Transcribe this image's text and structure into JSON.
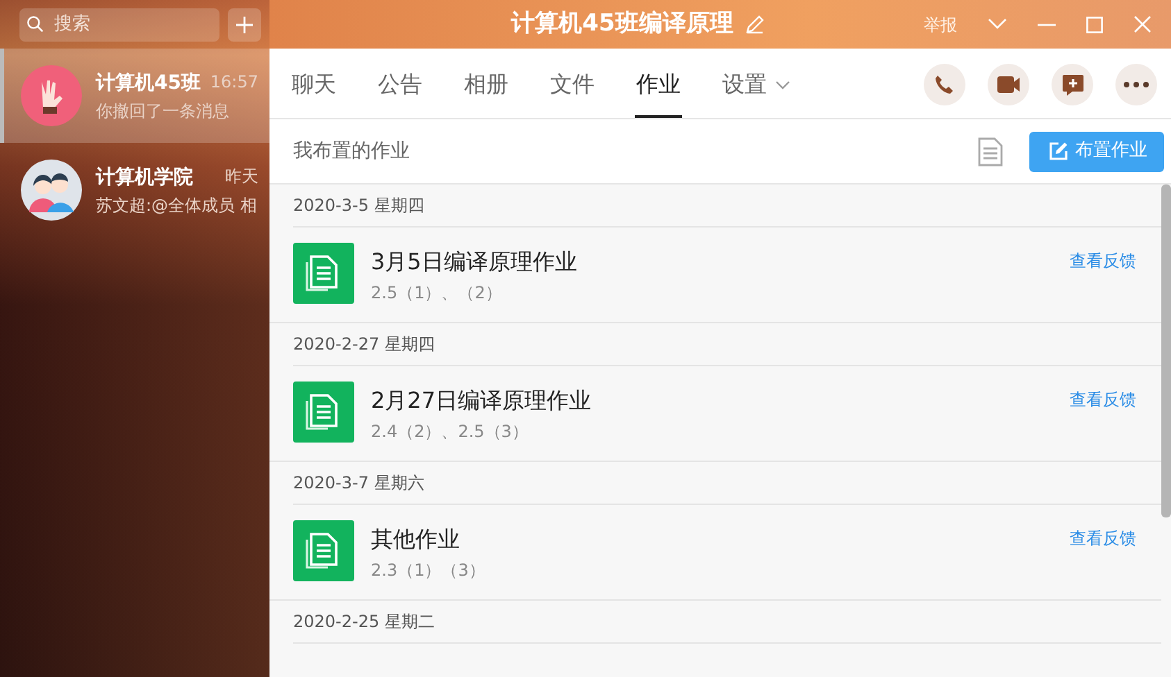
{
  "search": {
    "placeholder": "搜索"
  },
  "conversations": [
    {
      "name": "计算机45班",
      "time": "16:57",
      "preview": "你撤回了一条消息",
      "selected": true,
      "kind": "hand"
    },
    {
      "name": "计算机学院",
      "time": "昨天",
      "preview": "苏文超:@全体成员 相",
      "selected": false,
      "kind": "people"
    }
  ],
  "window": {
    "title": "计算机45班编译原理",
    "report": "举报"
  },
  "tabs": [
    {
      "label": "聊天",
      "selected": false,
      "dropdown": false
    },
    {
      "label": "公告",
      "selected": false,
      "dropdown": false
    },
    {
      "label": "相册",
      "selected": false,
      "dropdown": false
    },
    {
      "label": "文件",
      "selected": false,
      "dropdown": false
    },
    {
      "label": "作业",
      "selected": true,
      "dropdown": false
    },
    {
      "label": "设置",
      "selected": false,
      "dropdown": true
    }
  ],
  "subheader": {
    "title": "我布置的作业",
    "button": "布置作业"
  },
  "groups": [
    {
      "date": "2020-3-5 星期四",
      "items": [
        {
          "title": "3月5日编译原理作业",
          "subtitle": "2.5（1）、（2）",
          "action": "查看反馈"
        }
      ]
    },
    {
      "date": "2020-2-27 星期四",
      "items": [
        {
          "title": "2月27日编译原理作业",
          "subtitle": "2.4（2）、2.5（3）",
          "action": "查看反馈"
        }
      ]
    },
    {
      "date": "2020-3-7 星期六",
      "items": [
        {
          "title": "其他作业",
          "subtitle": "2.3（1）（3）",
          "action": "查看反馈"
        }
      ]
    },
    {
      "date": "2020-2-25 星期二"
    }
  ]
}
